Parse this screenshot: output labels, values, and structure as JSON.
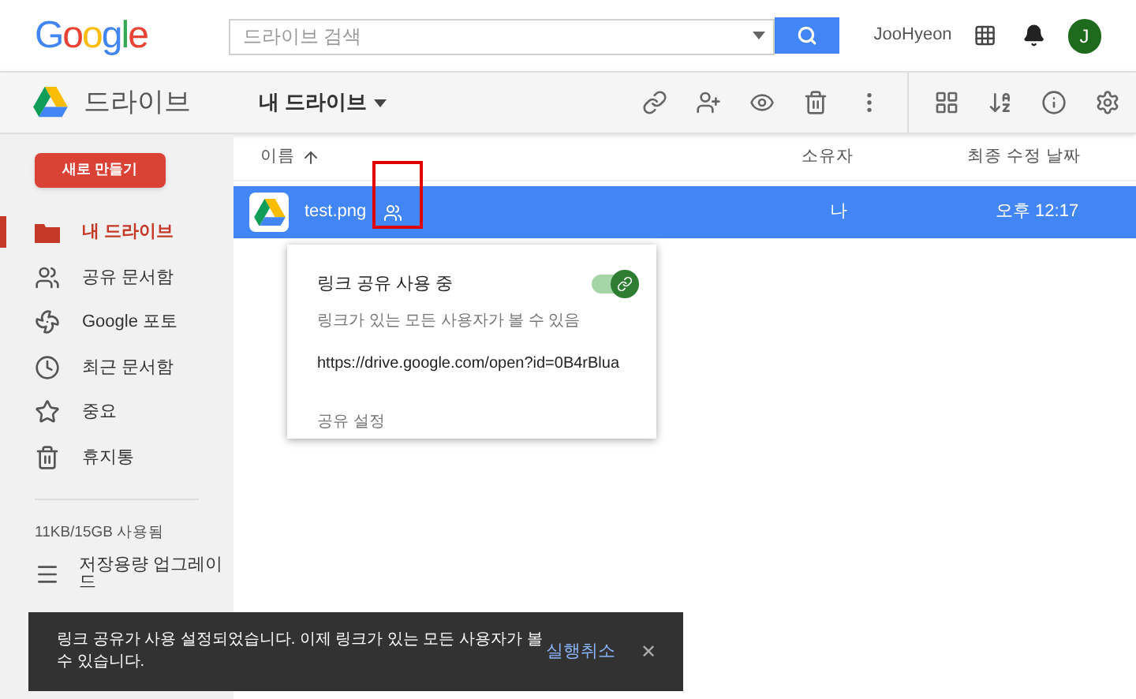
{
  "header": {
    "logo": "Google",
    "search": {
      "placeholder": "드라이브 검색"
    },
    "user": "JooHyeon",
    "avatar": "J"
  },
  "toolbar": {
    "app_name": "드라이브",
    "location": "내 드라이브"
  },
  "sidebar": {
    "new_button": "새로 만들기",
    "items": [
      {
        "label": "내 드라이브",
        "selected": true
      },
      {
        "label": "공유 문서함",
        "selected": false
      },
      {
        "label": "Google 포토",
        "selected": false
      },
      {
        "label": "최근 문서함",
        "selected": false
      },
      {
        "label": "중요",
        "selected": false
      },
      {
        "label": "휴지통",
        "selected": false
      }
    ],
    "storage": "11KB/15GB 사용됨",
    "upgrade": "저장용량 업그레이드"
  },
  "table": {
    "columns": [
      "이름",
      "소유자",
      "최종 수정 날짜"
    ],
    "rows": [
      {
        "name": "test.png",
        "owner": "나",
        "modified": "오후 12:17",
        "shared": true,
        "selected": true
      }
    ]
  },
  "share_popup": {
    "title": "링크 공유 사용 중",
    "on": true,
    "description": "링크가 있는 모든 사용자가 볼 수 있음",
    "link": "https://drive.google.com/open?id=0B4rBlua",
    "settings": "공유 설정"
  },
  "snackbar": {
    "message": "링크 공유가 사용 설정되었습니다. 이제 링크가 있는 모든 사용자가 볼 수 있습니다.",
    "action": "실행취소",
    "close": "✕"
  }
}
